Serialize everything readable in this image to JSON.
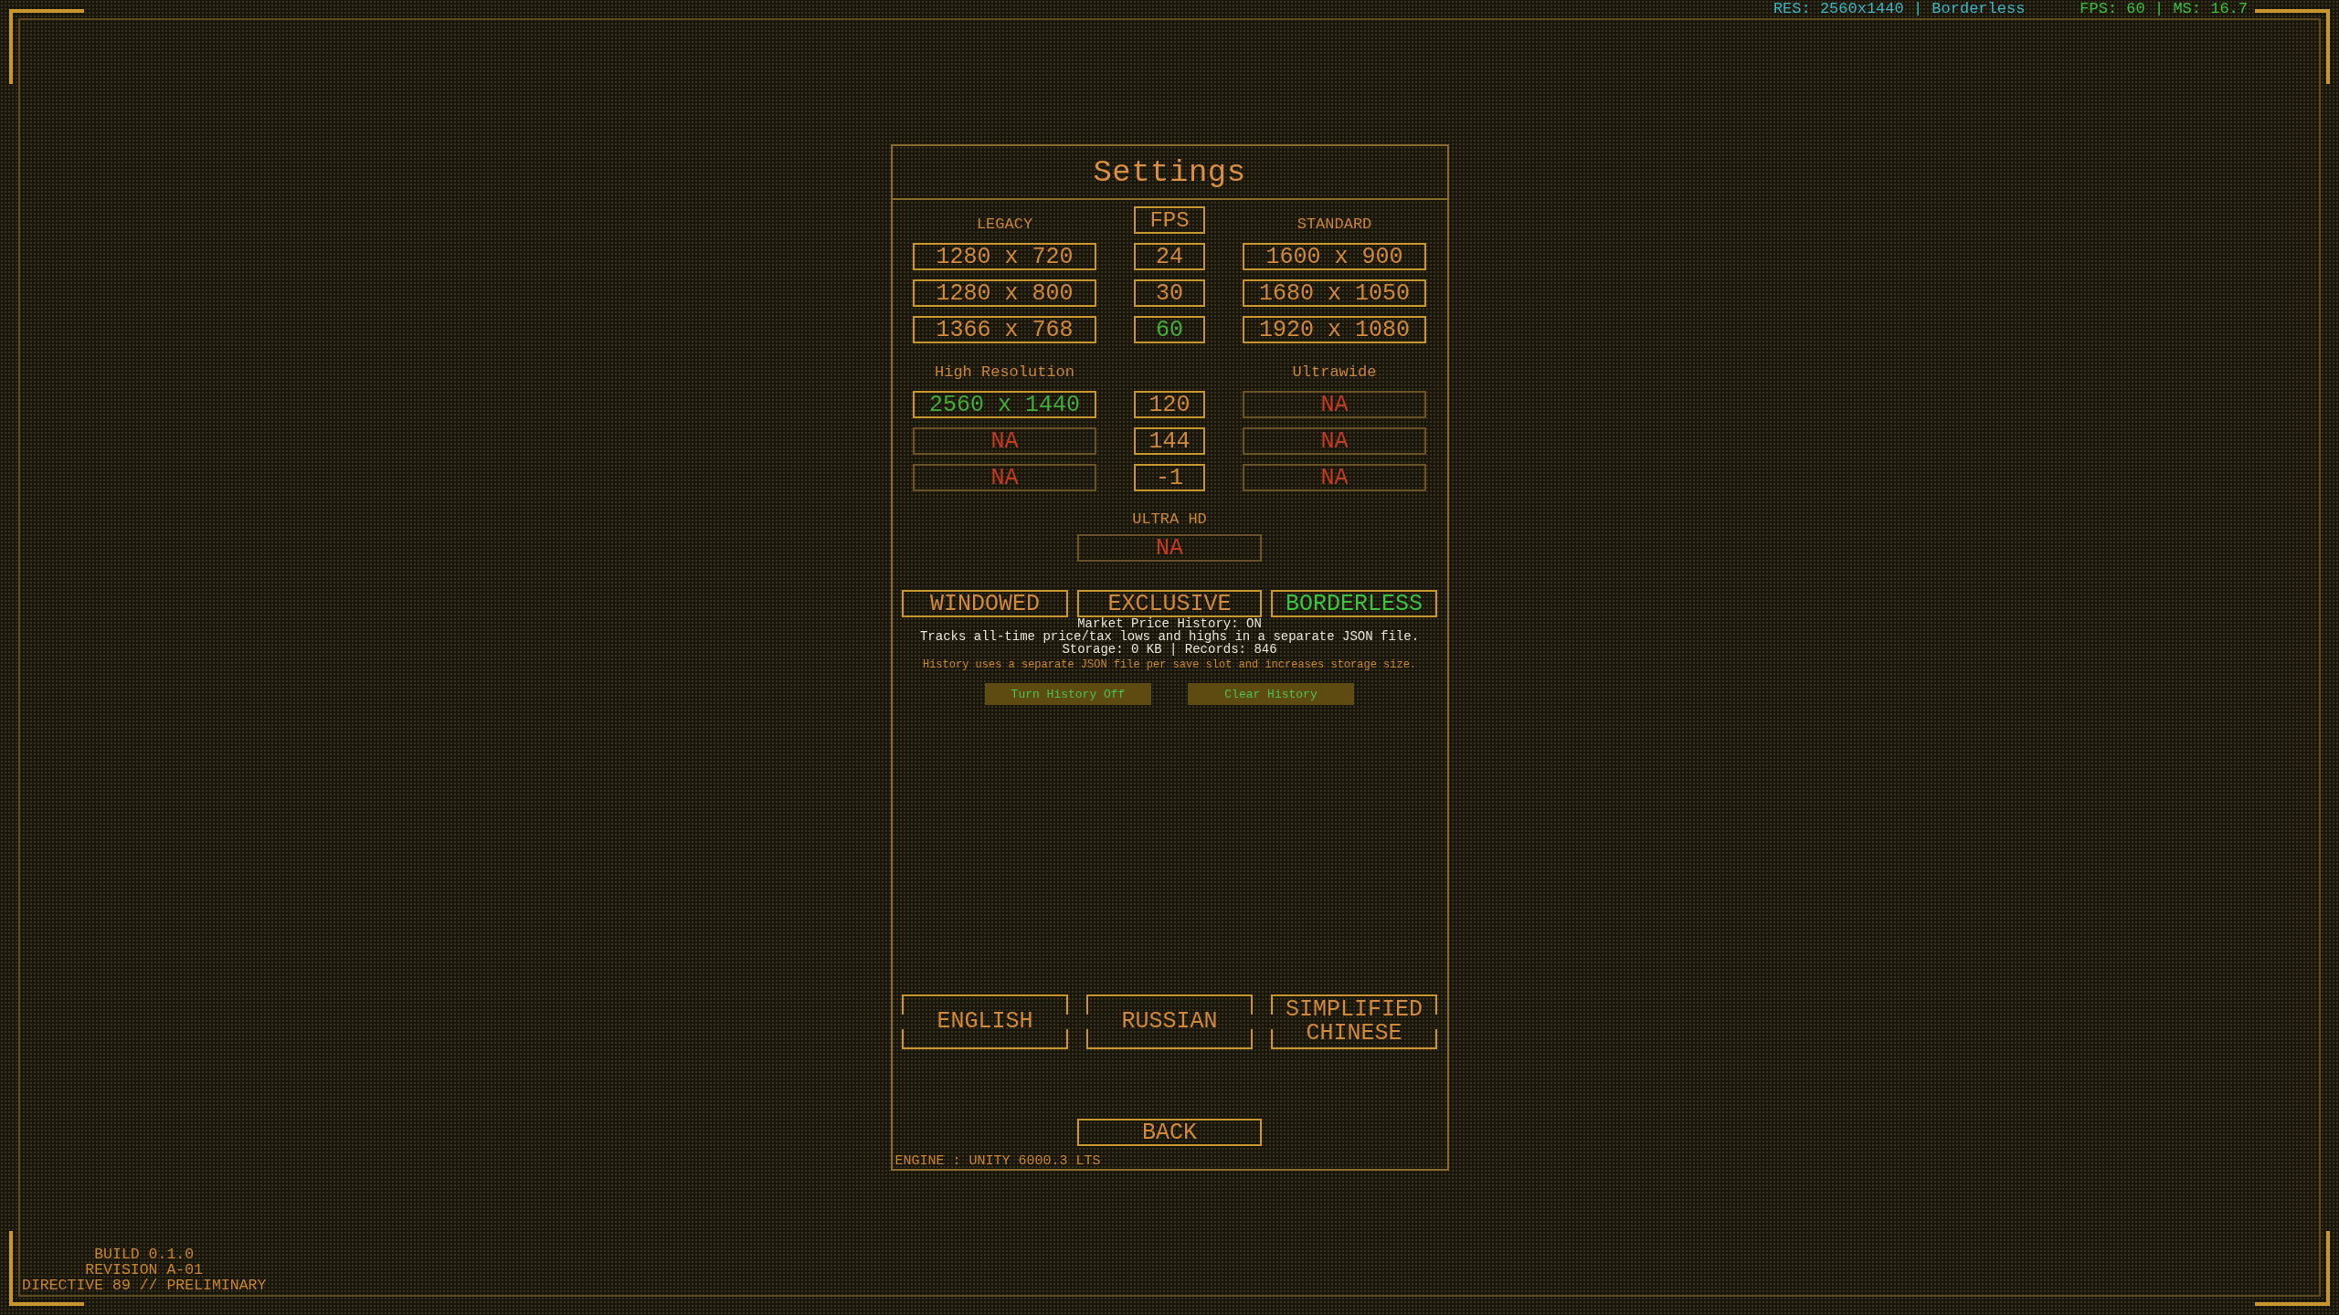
{
  "hud": {
    "resolution": "RES: 2560x1440 | Borderless",
    "performance": "FPS: 60 | MS: 16.7"
  },
  "panel": {
    "title": "Settings",
    "resolution_sections": [
      {
        "left_title": "LEGACY",
        "fps_title": "FPS",
        "right_title": "STANDARD",
        "left_options": [
          {
            "label": "1280 x 720",
            "selected": false,
            "disabled": false
          },
          {
            "label": "1280 x 800",
            "selected": false,
            "disabled": false
          },
          {
            "label": "1366 x 768",
            "selected": false,
            "disabled": false
          }
        ],
        "fps_options": [
          {
            "label": "24",
            "selected": false,
            "disabled": false
          },
          {
            "label": "30",
            "selected": false,
            "disabled": false
          },
          {
            "label": "60",
            "selected": true,
            "disabled": false
          }
        ],
        "right_options": [
          {
            "label": "1600 x 900",
            "selected": false,
            "disabled": false
          },
          {
            "label": "1680 x 1050",
            "selected": false,
            "disabled": false
          },
          {
            "label": "1920 x 1080",
            "selected": false,
            "disabled": false
          }
        ]
      },
      {
        "left_title": "High Resolution",
        "right_title": "Ultrawide",
        "left_options": [
          {
            "label": "2560 x 1440",
            "selected": true,
            "disabled": false
          },
          {
            "label": "NA",
            "selected": false,
            "disabled": true
          },
          {
            "label": "NA",
            "selected": false,
            "disabled": true
          }
        ],
        "fps_options": [
          {
            "label": "120",
            "selected": false,
            "disabled": false
          },
          {
            "label": "144",
            "selected": false,
            "disabled": false
          },
          {
            "label": "-1",
            "selected": false,
            "disabled": false
          }
        ],
        "right_options": [
          {
            "label": "NA",
            "selected": false,
            "disabled": true
          },
          {
            "label": "NA",
            "selected": false,
            "disabled": true
          },
          {
            "label": "NA",
            "selected": false,
            "disabled": true
          }
        ]
      }
    ],
    "ultra_hd": {
      "title": "ULTRA HD",
      "options": [
        {
          "label": "NA",
          "selected": false,
          "disabled": true
        }
      ]
    },
    "window_modes": [
      {
        "label": "WINDOWED",
        "selected": false
      },
      {
        "label": "EXCLUSIVE",
        "selected": false
      },
      {
        "label": "BORDERLESS",
        "selected": true
      }
    ],
    "market_history": {
      "status": "Market Price History: ON",
      "description": "Tracks all-time price/tax lows and highs in a separate JSON file.",
      "storage": "Storage: 0 KB | Records: 846",
      "note": "History uses a separate JSON file per save slot and increases storage size.",
      "buttons": [
        "Turn History Off",
        "Clear History"
      ]
    },
    "languages": [
      "ENGLISH",
      "RUSSIAN",
      "SIMPLIFIED CHINESE"
    ],
    "back": "BACK",
    "engine": "ENGINE : UNITY 6000.3 LTS"
  },
  "build_info": [
    "BUILD 0.1.0",
    "REVISION A-01",
    "DIRECTIVE 89 // PRELIMINARY"
  ]
}
